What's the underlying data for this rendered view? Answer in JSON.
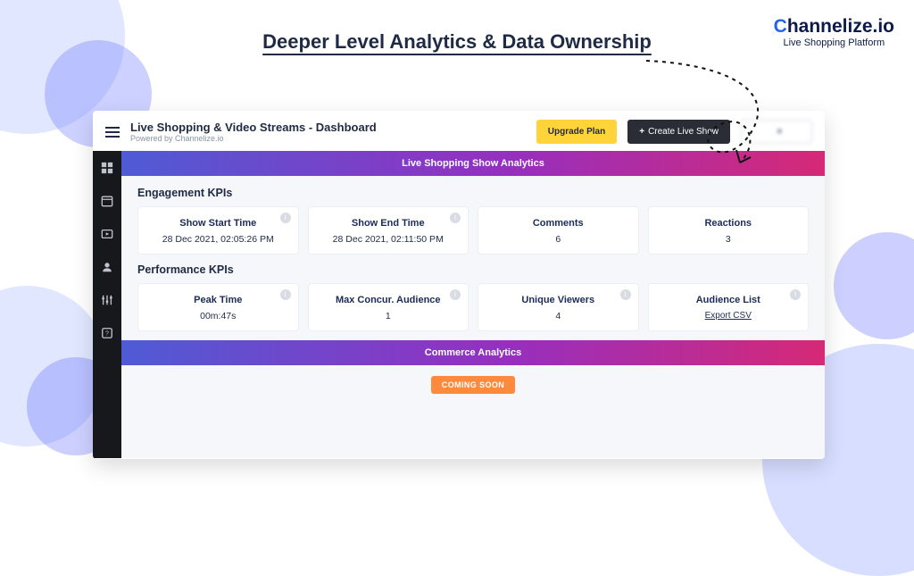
{
  "brand": {
    "name": "Channelize.io",
    "tagline": "Live Shopping Platform"
  },
  "page_title": "Deeper Level Analytics & Data Ownership",
  "dashboard": {
    "title": "Live Shopping & Video Streams - Dashboard",
    "powered_by": "Powered by Channelize.io",
    "upgrade_label": "Upgrade Plan",
    "create_label": "Create Live Show",
    "banner1": "Live Shopping Show Analytics",
    "engagement_heading": "Engagement KPIs",
    "engagement_kpis": [
      {
        "title": "Show Start Time",
        "value": "28 Dec 2021, 02:05:26 PM",
        "info": true
      },
      {
        "title": "Show End Time",
        "value": "28 Dec 2021, 02:11:50 PM",
        "info": true
      },
      {
        "title": "Comments",
        "value": "6",
        "info": false
      },
      {
        "title": "Reactions",
        "value": "3",
        "info": false
      }
    ],
    "performance_heading": "Performance KPIs",
    "performance_kpis": [
      {
        "title": "Peak Time",
        "value": "00m:47s",
        "info": true
      },
      {
        "title": "Max Concur. Audience",
        "value": "1",
        "info": true
      },
      {
        "title": "Unique Viewers",
        "value": "4",
        "info": true
      },
      {
        "title": "Audience List",
        "value": "Export CSV",
        "info": true,
        "is_link": true
      }
    ],
    "banner2": "Commerce Analytics",
    "coming_soon": "COMING SOON"
  },
  "sidenav": [
    {
      "name": "dashboard-grid"
    },
    {
      "name": "calendar"
    },
    {
      "name": "video-play"
    },
    {
      "name": "user"
    },
    {
      "name": "settings-sliders"
    },
    {
      "name": "help"
    }
  ]
}
